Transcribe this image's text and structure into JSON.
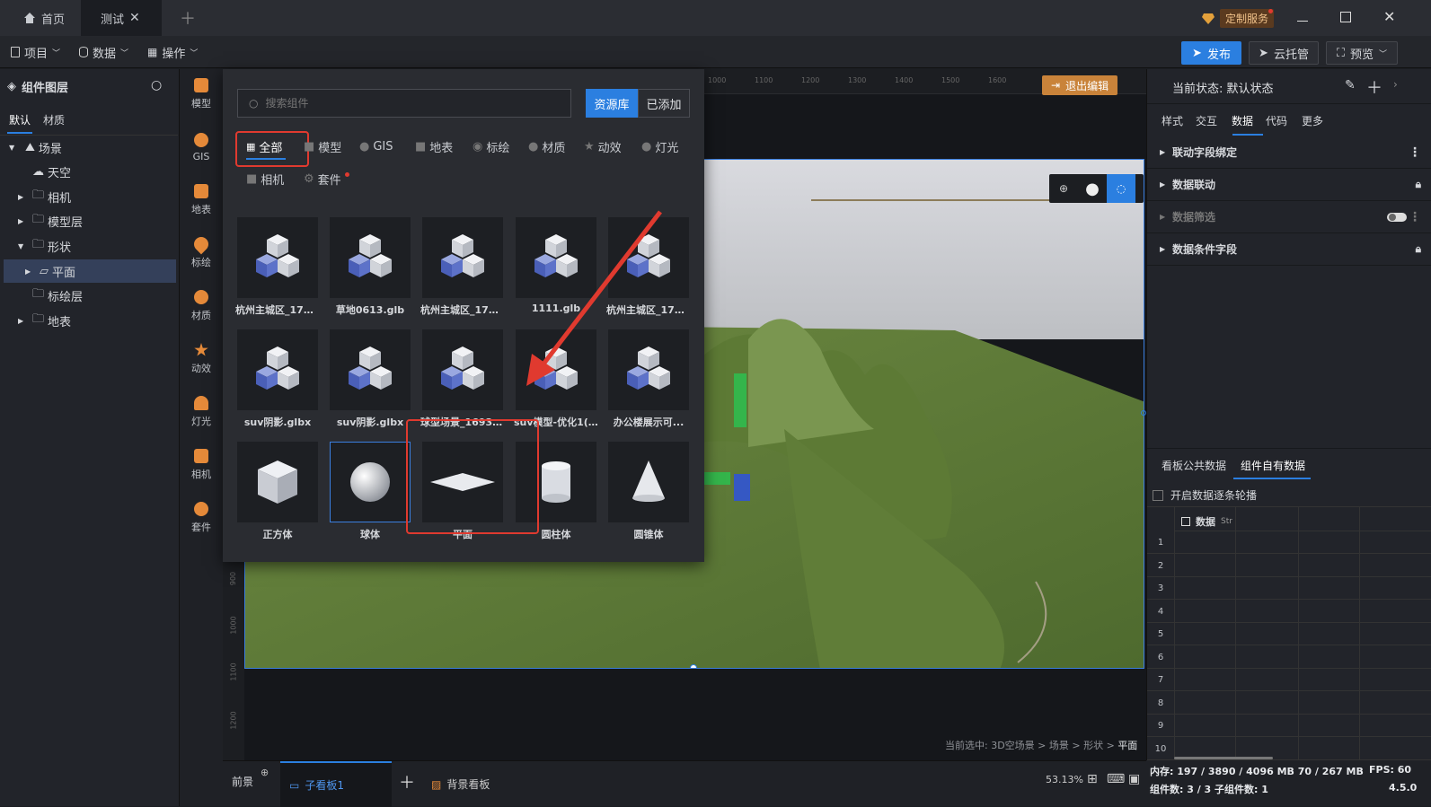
{
  "titlebar": {
    "tabs": [
      {
        "label": "首页"
      },
      {
        "label": "测试"
      }
    ],
    "custom_service": "定制服务"
  },
  "toolbar": {
    "menus": [
      {
        "label": "项目"
      },
      {
        "label": "数据"
      },
      {
        "label": "操作"
      }
    ],
    "publish": "发布",
    "cloud": "云托管",
    "preview": "预览"
  },
  "left": {
    "title": "组件图层",
    "tabs": [
      "默认",
      "材质"
    ],
    "tree": [
      {
        "label": "场景"
      },
      {
        "label": "天空"
      },
      {
        "label": "相机"
      },
      {
        "label": "模型层"
      },
      {
        "label": "形状"
      },
      {
        "label": "平面"
      },
      {
        "label": "标绘层"
      },
      {
        "label": "地表"
      }
    ]
  },
  "rail": [
    "模型",
    "GIS",
    "地表",
    "标绘",
    "材质",
    "动效",
    "灯光",
    "相机",
    "套件"
  ],
  "popup": {
    "search_placeholder": "搜索组件",
    "lib_btn": "资源库",
    "added_btn": "已添加",
    "categories": [
      "全部",
      "模型",
      "GIS",
      "地表",
      "标绘",
      "材质",
      "动效",
      "灯光",
      "相机",
      "套件"
    ],
    "cards": [
      "杭州主城区_174...",
      "草地0613.glb",
      "杭州主城区_174...",
      "1111.glb",
      "杭州主城区_174...",
      "suv阴影.glbx",
      "suv阴影.glbx",
      "球型场景_16937...",
      "suv模型-优化1(1...",
      "办公楼展示可...",
      "正方体",
      "球体",
      "平面",
      "圆柱体",
      "圆锥体"
    ]
  },
  "canvas": {
    "exit_edit": "退出编辑",
    "ruler_top": [
      "1000",
      "1100",
      "1200",
      "1300",
      "1400",
      "1500",
      "1600"
    ],
    "ruler_left": [
      "900",
      "1000",
      "1100",
      "1200"
    ],
    "breadcrumb": "当前选中: 3D空场景 > 场景 > 形状 > ",
    "breadcrumb_current": "平面"
  },
  "bottom": {
    "front": "前景",
    "child_board": "子看板1",
    "bg_board": "背景看板",
    "zoom": "53.13%"
  },
  "right": {
    "state_label": "当前状态:  默认状态",
    "tabs": [
      "样式",
      "交互",
      "数据",
      "代码",
      "更多"
    ],
    "sections": [
      "联动字段绑定",
      "数据联动",
      "数据筛选",
      "数据条件字段"
    ],
    "data_tabs": [
      "看板公共数据",
      "组件自有数据"
    ],
    "carousel": "开启数据逐条轮播",
    "col_header": "数据",
    "col_type": "Str",
    "rows": [
      "1",
      "2",
      "3",
      "4",
      "5",
      "6",
      "7",
      "8",
      "9",
      "10"
    ]
  },
  "status": {
    "memory": "内存:  197 / 3890 / 4096 MB  70 / 267 MB",
    "fps": "FPS: 60",
    "components": "组件数: 3 / 3    子组件数: 1",
    "version": "4.5.0"
  },
  "colors": {
    "accent": "#2b7fe0",
    "highlight": "#e03a2f",
    "orange": "#c9833a"
  }
}
